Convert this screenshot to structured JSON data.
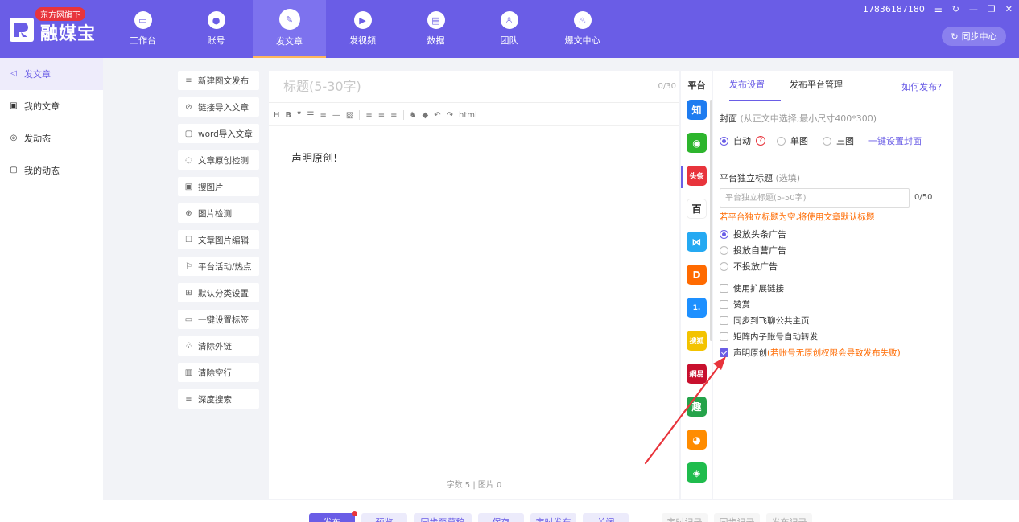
{
  "app": {
    "name": "融媒宝",
    "badge": "东方网旗下",
    "account": "17836187180",
    "sync_label": "同步中心"
  },
  "nav": [
    {
      "label": "工作台",
      "icon": "monitor-icon",
      "glyph": "▭"
    },
    {
      "label": "账号",
      "icon": "user-icon",
      "glyph": "●"
    },
    {
      "label": "发文章",
      "icon": "pen-icon",
      "glyph": "✎"
    },
    {
      "label": "发视频",
      "icon": "play-icon",
      "glyph": "▶"
    },
    {
      "label": "数据",
      "icon": "chart-icon",
      "glyph": "▤"
    },
    {
      "label": "团队",
      "icon": "team-icon",
      "glyph": "♙"
    },
    {
      "label": "爆文中心",
      "icon": "flame-icon",
      "glyph": "♨"
    }
  ],
  "sidebar": [
    {
      "label": "发文章",
      "icon": "send-icon",
      "glyph": "◁"
    },
    {
      "label": "我的文章",
      "icon": "document-icon",
      "glyph": "▣"
    },
    {
      "label": "发动态",
      "icon": "target-icon",
      "glyph": "◎"
    },
    {
      "label": "我的动态",
      "icon": "bubble-icon",
      "glyph": "▢"
    }
  ],
  "tools": [
    {
      "label": "新建图文发布",
      "icon": "new-doc-icon",
      "glyph": "≡"
    },
    {
      "label": "链接导入文章",
      "icon": "link-icon",
      "glyph": "⊘"
    },
    {
      "label": "word导入文章",
      "icon": "word-icon",
      "glyph": "▢"
    },
    {
      "label": "文章原创检测",
      "icon": "check-circle-icon",
      "glyph": "◌"
    },
    {
      "label": "搜图片",
      "icon": "image-icon",
      "glyph": "▣"
    },
    {
      "label": "图片检测",
      "icon": "zoom-icon",
      "glyph": "⊕"
    },
    {
      "label": "文章图片编辑",
      "icon": "edit-icon",
      "glyph": "☐"
    },
    {
      "label": "平台活动/热点",
      "icon": "flag-icon",
      "glyph": "⚐"
    },
    {
      "label": "默认分类设置",
      "icon": "grid-icon",
      "glyph": "⊞"
    },
    {
      "label": "一键设置标签",
      "icon": "tag-icon",
      "glyph": "▭"
    },
    {
      "label": "清除外链",
      "icon": "unlink-icon",
      "glyph": "♧"
    },
    {
      "label": "清除空行",
      "icon": "trash-icon",
      "glyph": "▥"
    },
    {
      "label": "深度搜索",
      "icon": "deep-search-icon",
      "glyph": "≡"
    }
  ],
  "editor": {
    "title_placeholder": "标题(5-30字)",
    "title_count": "0/30",
    "toolbar_html": "html",
    "body": "声明原创!",
    "stats": "字数 5  |  图片 0"
  },
  "platforms": {
    "title": "平台",
    "items": [
      {
        "name": "zhihu-icon",
        "glyph": "知",
        "color": "#1e7cf0"
      },
      {
        "name": "wechat-icon",
        "glyph": "◉",
        "color": "#2db52d"
      },
      {
        "name": "toutiao-icon",
        "glyph": "头条",
        "color": "#e8343c"
      },
      {
        "name": "baijia-icon",
        "glyph": "百",
        "color": "#ffffff"
      },
      {
        "name": "dayu-icon",
        "glyph": "⋈",
        "color": "#25a9f2"
      },
      {
        "name": "sohu-d-icon",
        "glyph": "D",
        "color": "#ff6a00"
      },
      {
        "name": "yidian-icon",
        "glyph": "1.",
        "color": "#1e90ff"
      },
      {
        "name": "souhu-icon",
        "glyph": "搜狐",
        "color": "#f3c300"
      },
      {
        "name": "netease-icon",
        "glyph": "網易",
        "color": "#c8102e"
      },
      {
        "name": "qutoutiao-icon",
        "glyph": "趣",
        "color": "#25a34a"
      },
      {
        "name": "weibo-icon",
        "glyph": "◕",
        "color": "#ff8c00"
      },
      {
        "name": "iqiyi-icon",
        "glyph": "◈",
        "color": "#1fbc4d"
      }
    ]
  },
  "panel": {
    "tab_publish": "发布设置",
    "tab_manage": "发布平台管理",
    "help": "如何发布?",
    "cover_label": "封面",
    "cover_hint": "(从正文中选择,最小尺寸400*300)",
    "cover_auto": "自动",
    "cover_single": "单图",
    "cover_triple": "三图",
    "cover_link": "一键设置封面",
    "subtitle_label": "平台独立标题",
    "subtitle_hint": "(选填)",
    "subtitle_placeholder": "平台独立标题(5-50字)",
    "subtitle_count": "0/50",
    "warning": "若平台独立标题为空,将使用文章默认标题",
    "ad_options": [
      "投放头条广告",
      "投放自营广告",
      "不投放广告"
    ],
    "checks": [
      "使用扩展链接",
      "赞赏",
      "同步到飞聊公共主页",
      "矩阵内子账号自动转发"
    ],
    "original_label": "声明原创",
    "original_hint": "(若账号无原创权限会导致发布失败)"
  },
  "window": {
    "menu": "☰",
    "refresh": "↻",
    "minimize": "—",
    "restore": "❐",
    "close": "✕"
  },
  "bottom": {
    "publish": "发布",
    "preview": "预览",
    "sync_draft": "同步至草稿",
    "save": "保存",
    "schedule": "定时发布",
    "close": "关闭",
    "disabled_a": "定时记录",
    "disabled_b": "同步记录",
    "disabled_c": "发布记录"
  },
  "colors": {
    "brand": "#6a5de6",
    "warning": "#ff6a00",
    "annotation": "#e8343c"
  }
}
